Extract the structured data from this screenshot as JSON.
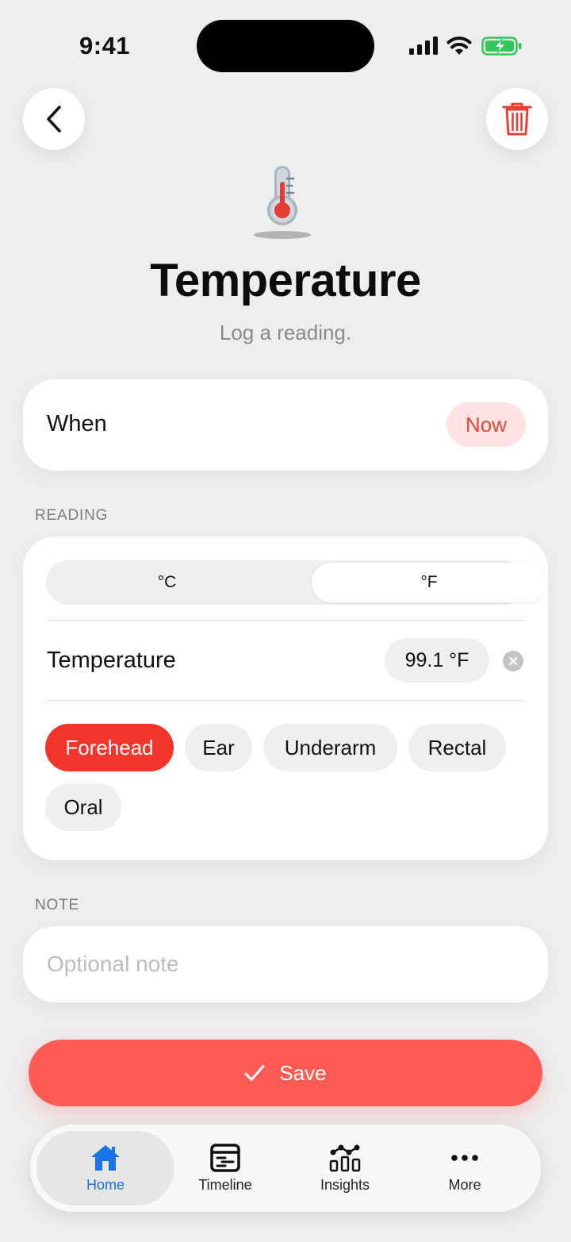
{
  "status_bar": {
    "time": "9:41"
  },
  "header": {
    "title": "Temperature",
    "subtitle": "Log a reading."
  },
  "when": {
    "label": "When",
    "value": "Now"
  },
  "reading": {
    "section_label": "READING",
    "units": [
      "°C",
      "°F"
    ],
    "selected_unit": "°F",
    "temperature_label": "Temperature",
    "temperature_value": "99.1 °F",
    "sites": [
      "Forehead",
      "Ear",
      "Underarm",
      "Rectal",
      "Oral"
    ],
    "selected_site": "Forehead"
  },
  "note": {
    "section_label": "NOTE",
    "placeholder": "Optional note"
  },
  "save": {
    "label": "Save"
  },
  "tabs": [
    {
      "label": "Home",
      "icon": "home-icon",
      "active": true
    },
    {
      "label": "Timeline",
      "icon": "timeline-icon",
      "active": false
    },
    {
      "label": "Insights",
      "icon": "insights-icon",
      "active": false
    },
    {
      "label": "More",
      "icon": "more-icon",
      "active": false
    }
  ],
  "colors": {
    "accent": "#f2352b",
    "save": "#fd5b53",
    "now_bg": "#fde3e1",
    "tab_active": "#1a73e8",
    "battery": "#34c759"
  }
}
